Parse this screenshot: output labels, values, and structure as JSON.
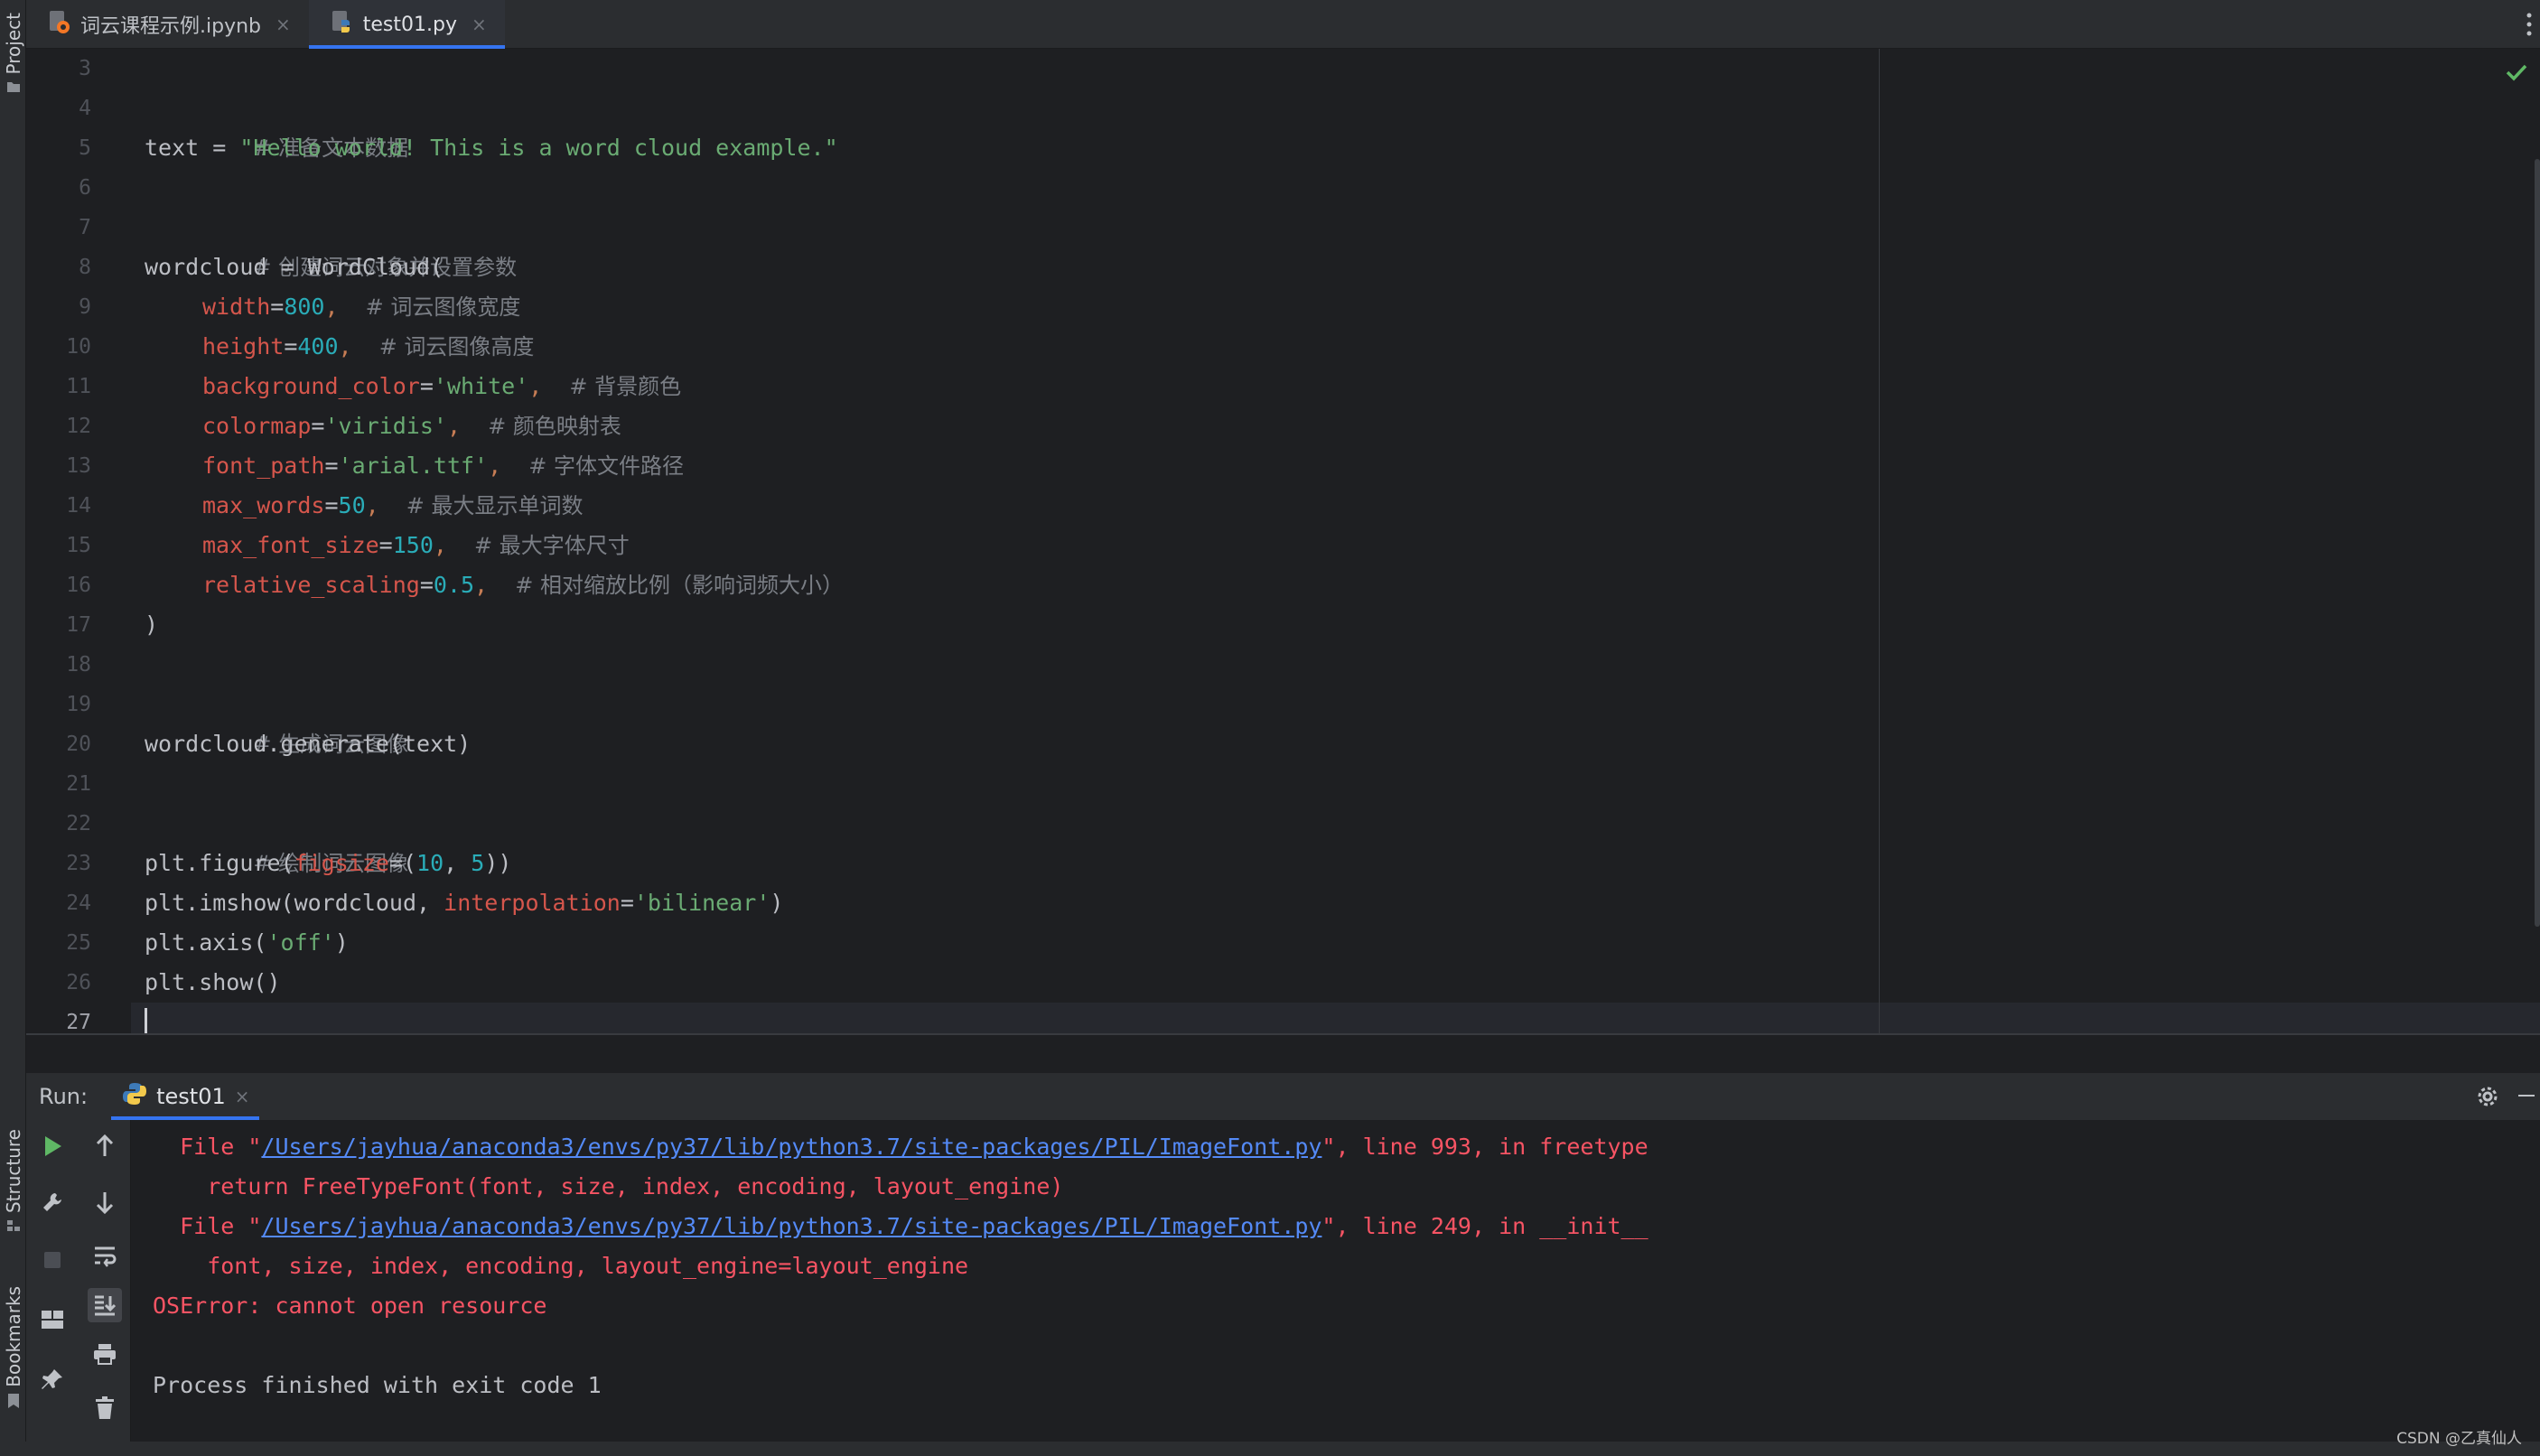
{
  "left_stripe": {
    "project_label": "Project",
    "structure_label": "Structure",
    "bookmarks_label": "Bookmarks"
  },
  "tabs": [
    {
      "label": "词云课程示例.ipynb",
      "icon": "jupyter-file-icon",
      "active": false
    },
    {
      "label": "test01.py",
      "icon": "python-file-icon",
      "active": true
    }
  ],
  "tab_close_glyph": "×",
  "editor": {
    "line_numbers": [
      "3",
      "4",
      "5",
      "6",
      "7",
      "8",
      "9",
      "10",
      "11",
      "12",
      "13",
      "14",
      "15",
      "16",
      "17",
      "18",
      "19",
      "20",
      "21",
      "22",
      "23",
      "24",
      "25",
      "26",
      "27"
    ],
    "current_line": "27",
    "lines": {
      "l4_comment": "# 准备文本数据",
      "l5_var": "text",
      "l5_op": " = ",
      "l5_str": "\"Hello world! This is a word cloud example.\"",
      "l7_comment": "# 创建词云对象并设置参数",
      "l8_code": "wordcloud = WordCloud(",
      "l9_param": "width",
      "l9_eq": "=",
      "l9_val": "800",
      "l9_sep": ",  ",
      "l9_comment": "# 词云图像宽度",
      "l10_param": "height",
      "l10_eq": "=",
      "l10_val": "400",
      "l10_sep": ",  ",
      "l10_comment": "# 词云图像高度",
      "l11_param": "background_color",
      "l11_eq": "=",
      "l11_val": "'white'",
      "l11_sep": ",  ",
      "l11_comment": "# 背景颜色",
      "l12_param": "colormap",
      "l12_eq": "=",
      "l12_val": "'viridis'",
      "l12_sep": ",  ",
      "l12_comment": "# 颜色映射表",
      "l13_param": "font_path",
      "l13_eq": "=",
      "l13_val": "'arial.ttf'",
      "l13_sep": ",  ",
      "l13_comment": "# 字体文件路径",
      "l14_param": "max_words",
      "l14_eq": "=",
      "l14_val": "50",
      "l14_sep": ",  ",
      "l14_comment": "# 最大显示单词数",
      "l15_param": "max_font_size",
      "l15_eq": "=",
      "l15_val": "150",
      "l15_sep": ",  ",
      "l15_comment": "# 最大字体尺寸",
      "l16_param": "relative_scaling",
      "l16_eq": "=",
      "l16_val": "0.5",
      "l16_sep": ",  ",
      "l16_comment": "# 相对缩放比例（影响词频大小）",
      "l17_code": ")",
      "l19_comment": "# 生成词云图像",
      "l20_code": "wordcloud.generate(text)",
      "l22_comment": "# 绘制词云图像",
      "l23_a": "plt.figure(",
      "l23_param": "figsize",
      "l23_b": "=(",
      "l23_n1": "10",
      "l23_c": ", ",
      "l23_n2": "5",
      "l23_d": "))",
      "l24_a": "plt.imshow(wordcloud, ",
      "l24_param": "interpolation",
      "l24_b": "=",
      "l24_str": "'bilinear'",
      "l24_c": ")",
      "l25_a": "plt.axis(",
      "l25_str": "'off'",
      "l25_b": ")",
      "l26_code": "plt.show()"
    }
  },
  "run_panel": {
    "label": "Run:",
    "tab_label": "test01",
    "console": {
      "l1_pre": "  File \"",
      "l1_link": "/Users/jayhua/anaconda3/envs/py37/lib/python3.7/site-packages/PIL/ImageFont.py",
      "l1_post": "\", line 993, in freetype",
      "l2": "    return FreeTypeFont(font, size, index, encoding, layout_engine)",
      "l3_pre": "  File \"",
      "l3_link": "/Users/jayhua/anaconda3/envs/py37/lib/python3.7/site-packages/PIL/ImageFont.py",
      "l3_post": "\", line 249, in __init__",
      "l4": "    font, size, index, encoding, layout_engine=layout_engine",
      "l5": "OSError: cannot open resource",
      "l7": "Process finished with exit code 1"
    }
  },
  "watermark": "CSDN @乙真仙人",
  "colors": {
    "accent": "#3574f0",
    "error_text": "#f75464",
    "link": "#548af7",
    "string": "#6aab73",
    "number": "#2aacb8",
    "param": "#d5564c",
    "comment": "#7a7e85",
    "success_check": "#5fb865"
  }
}
